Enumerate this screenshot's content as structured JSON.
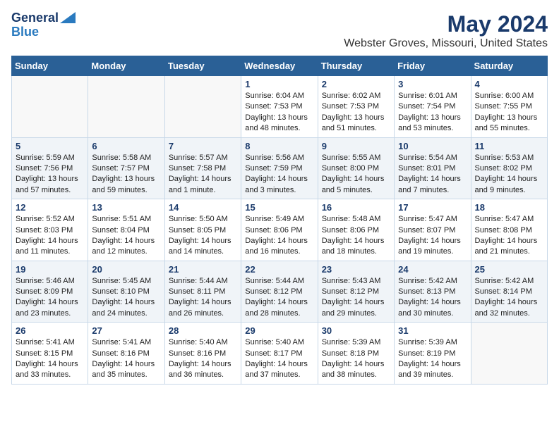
{
  "logo": {
    "line1": "General",
    "line2": "Blue"
  },
  "title": "May 2024",
  "subtitle": "Webster Groves, Missouri, United States",
  "weekdays": [
    "Sunday",
    "Monday",
    "Tuesday",
    "Wednesday",
    "Thursday",
    "Friday",
    "Saturday"
  ],
  "weeks": [
    [
      {
        "day": "",
        "content": ""
      },
      {
        "day": "",
        "content": ""
      },
      {
        "day": "",
        "content": ""
      },
      {
        "day": "1",
        "content": "Sunrise: 6:04 AM\nSunset: 7:53 PM\nDaylight: 13 hours\nand 48 minutes."
      },
      {
        "day": "2",
        "content": "Sunrise: 6:02 AM\nSunset: 7:53 PM\nDaylight: 13 hours\nand 51 minutes."
      },
      {
        "day": "3",
        "content": "Sunrise: 6:01 AM\nSunset: 7:54 PM\nDaylight: 13 hours\nand 53 minutes."
      },
      {
        "day": "4",
        "content": "Sunrise: 6:00 AM\nSunset: 7:55 PM\nDaylight: 13 hours\nand 55 minutes."
      }
    ],
    [
      {
        "day": "5",
        "content": "Sunrise: 5:59 AM\nSunset: 7:56 PM\nDaylight: 13 hours\nand 57 minutes."
      },
      {
        "day": "6",
        "content": "Sunrise: 5:58 AM\nSunset: 7:57 PM\nDaylight: 13 hours\nand 59 minutes."
      },
      {
        "day": "7",
        "content": "Sunrise: 5:57 AM\nSunset: 7:58 PM\nDaylight: 14 hours\nand 1 minute."
      },
      {
        "day": "8",
        "content": "Sunrise: 5:56 AM\nSunset: 7:59 PM\nDaylight: 14 hours\nand 3 minutes."
      },
      {
        "day": "9",
        "content": "Sunrise: 5:55 AM\nSunset: 8:00 PM\nDaylight: 14 hours\nand 5 minutes."
      },
      {
        "day": "10",
        "content": "Sunrise: 5:54 AM\nSunset: 8:01 PM\nDaylight: 14 hours\nand 7 minutes."
      },
      {
        "day": "11",
        "content": "Sunrise: 5:53 AM\nSunset: 8:02 PM\nDaylight: 14 hours\nand 9 minutes."
      }
    ],
    [
      {
        "day": "12",
        "content": "Sunrise: 5:52 AM\nSunset: 8:03 PM\nDaylight: 14 hours\nand 11 minutes."
      },
      {
        "day": "13",
        "content": "Sunrise: 5:51 AM\nSunset: 8:04 PM\nDaylight: 14 hours\nand 12 minutes."
      },
      {
        "day": "14",
        "content": "Sunrise: 5:50 AM\nSunset: 8:05 PM\nDaylight: 14 hours\nand 14 minutes."
      },
      {
        "day": "15",
        "content": "Sunrise: 5:49 AM\nSunset: 8:06 PM\nDaylight: 14 hours\nand 16 minutes."
      },
      {
        "day": "16",
        "content": "Sunrise: 5:48 AM\nSunset: 8:06 PM\nDaylight: 14 hours\nand 18 minutes."
      },
      {
        "day": "17",
        "content": "Sunrise: 5:47 AM\nSunset: 8:07 PM\nDaylight: 14 hours\nand 19 minutes."
      },
      {
        "day": "18",
        "content": "Sunrise: 5:47 AM\nSunset: 8:08 PM\nDaylight: 14 hours\nand 21 minutes."
      }
    ],
    [
      {
        "day": "19",
        "content": "Sunrise: 5:46 AM\nSunset: 8:09 PM\nDaylight: 14 hours\nand 23 minutes."
      },
      {
        "day": "20",
        "content": "Sunrise: 5:45 AM\nSunset: 8:10 PM\nDaylight: 14 hours\nand 24 minutes."
      },
      {
        "day": "21",
        "content": "Sunrise: 5:44 AM\nSunset: 8:11 PM\nDaylight: 14 hours\nand 26 minutes."
      },
      {
        "day": "22",
        "content": "Sunrise: 5:44 AM\nSunset: 8:12 PM\nDaylight: 14 hours\nand 28 minutes."
      },
      {
        "day": "23",
        "content": "Sunrise: 5:43 AM\nSunset: 8:12 PM\nDaylight: 14 hours\nand 29 minutes."
      },
      {
        "day": "24",
        "content": "Sunrise: 5:42 AM\nSunset: 8:13 PM\nDaylight: 14 hours\nand 30 minutes."
      },
      {
        "day": "25",
        "content": "Sunrise: 5:42 AM\nSunset: 8:14 PM\nDaylight: 14 hours\nand 32 minutes."
      }
    ],
    [
      {
        "day": "26",
        "content": "Sunrise: 5:41 AM\nSunset: 8:15 PM\nDaylight: 14 hours\nand 33 minutes."
      },
      {
        "day": "27",
        "content": "Sunrise: 5:41 AM\nSunset: 8:16 PM\nDaylight: 14 hours\nand 35 minutes."
      },
      {
        "day": "28",
        "content": "Sunrise: 5:40 AM\nSunset: 8:16 PM\nDaylight: 14 hours\nand 36 minutes."
      },
      {
        "day": "29",
        "content": "Sunrise: 5:40 AM\nSunset: 8:17 PM\nDaylight: 14 hours\nand 37 minutes."
      },
      {
        "day": "30",
        "content": "Sunrise: 5:39 AM\nSunset: 8:18 PM\nDaylight: 14 hours\nand 38 minutes."
      },
      {
        "day": "31",
        "content": "Sunrise: 5:39 AM\nSunset: 8:19 PM\nDaylight: 14 hours\nand 39 minutes."
      },
      {
        "day": "",
        "content": ""
      }
    ]
  ]
}
